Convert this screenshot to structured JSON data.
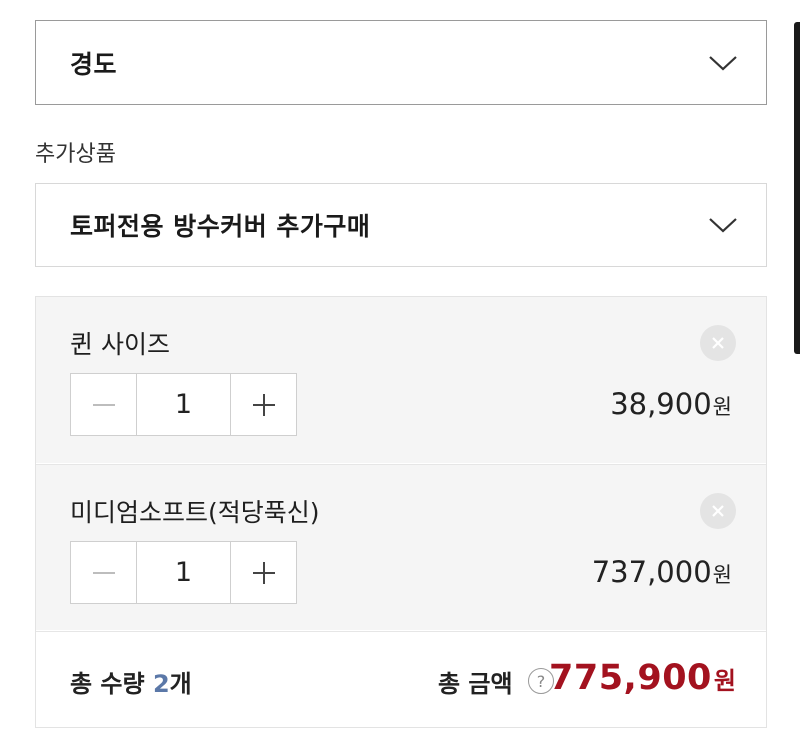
{
  "selects": {
    "firmness": {
      "value": "경도"
    },
    "addon": {
      "value": "토퍼전용 방수커버 추가구매"
    }
  },
  "addon_label": "추가상품",
  "options": [
    {
      "name": "퀸 사이즈",
      "qty": "1",
      "price": "38,900",
      "currency": "원"
    },
    {
      "name": "미디엄소프트(적당푹신)",
      "qty": "1",
      "price": "737,000",
      "currency": "원"
    }
  ],
  "total": {
    "qty_prefix": "총 수량",
    "qty_value": "2",
    "qty_unit": "개",
    "amount_label": "총 금액",
    "help_symbol": "?",
    "amount": "775,900",
    "currency": "원"
  },
  "colors": {
    "total_amount": "#a3121f",
    "total_qty_number": "#5b78a8",
    "option_bg": "#f5f5f5"
  },
  "icons": [
    "chevron-down-icon",
    "close-icon",
    "minus-icon",
    "plus-icon",
    "help-icon"
  ]
}
